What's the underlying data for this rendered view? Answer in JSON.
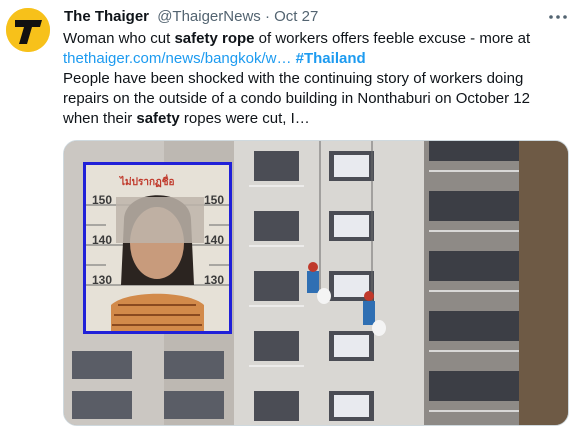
{
  "tweet": {
    "display_name": "The Thaiger",
    "handle": "@ThaigerNews",
    "separator": "·",
    "date": "Oct 27",
    "text": {
      "l1_a": "Woman who cut ",
      "l1_b": "safety rope",
      "l1_c": " of workers offers feeble excuse - more at",
      "link": "thethaiger.com/news/bangkok/w…",
      "hashtag": "#Thailand",
      "l3": "People have been shocked with the continuing story of workers doing",
      "l4": "repairs on the outside of a condo building in Nonthaburi on October 12",
      "l5_a": "when their ",
      "l5_b": "safety",
      "l5_c": " ropes were cut, I…"
    },
    "avatar_icon": "thaiger-logo-icon",
    "more_icon": "more-horizontal-icon"
  },
  "mugshot": {
    "header_text": "ไม่ปรากฏชื่อ",
    "scale_labels": [
      "150",
      "150",
      "140",
      "140",
      "130",
      "130"
    ]
  },
  "colors": {
    "accent": "#1d9bf0",
    "text": "#0f1419",
    "muted": "#536471",
    "avatar_bg": "#f7c11a",
    "mugshot_border": "#2020d8"
  }
}
